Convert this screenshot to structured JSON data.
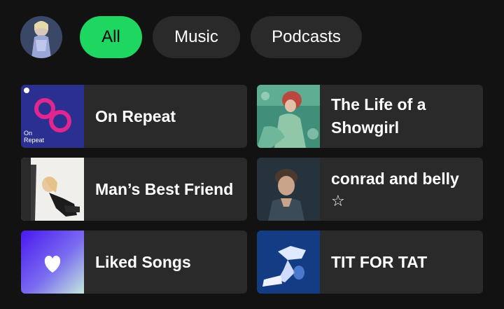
{
  "header": {
    "chips": [
      {
        "label": "All",
        "active": true
      },
      {
        "label": "Music",
        "active": false
      },
      {
        "label": "Podcasts",
        "active": false
      }
    ]
  },
  "grid": {
    "items": [
      {
        "title": "On Repeat",
        "thumb_label": "On Repeat"
      },
      {
        "title": "The Life of a Showgirl"
      },
      {
        "title": "Man’s Best Friend"
      },
      {
        "title": "conrad and belly",
        "subtitle": "☆"
      },
      {
        "title": "Liked Songs",
        "thumb_icon": "heart-icon"
      },
      {
        "title": "TIT FOR TAT"
      }
    ]
  },
  "colors": {
    "background": "#121212",
    "card": "#2a2a2a",
    "accent": "#1ed760",
    "on_repeat_bg": "#2b2f8f",
    "on_repeat_logo": "#e2268f"
  }
}
